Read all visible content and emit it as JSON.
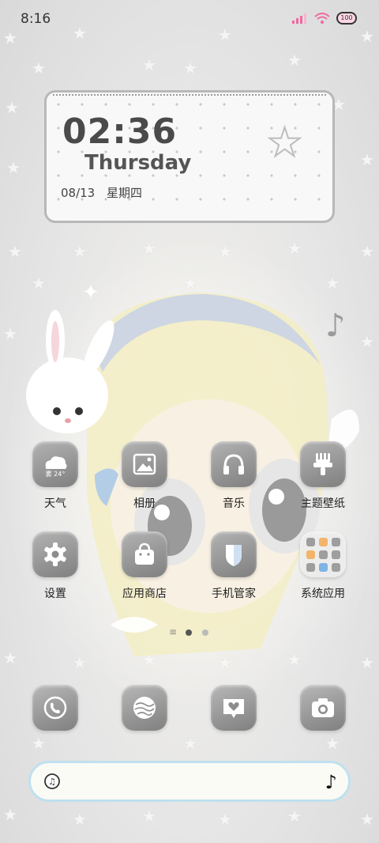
{
  "status_bar": {
    "time": "8:16",
    "battery": "100"
  },
  "widget": {
    "time": "02:36",
    "weekday": "Thursday",
    "date": "08/13",
    "weekday_cn": "星期四"
  },
  "apps": [
    {
      "label": "天气",
      "badge": "雾 24°"
    },
    {
      "label": "相册"
    },
    {
      "label": "音乐"
    },
    {
      "label": "主题壁纸"
    },
    {
      "label": "设置"
    },
    {
      "label": "应用商店"
    },
    {
      "label": "手机管家"
    },
    {
      "label": "系统应用"
    }
  ],
  "pager": {
    "pages": 2,
    "active": 1
  },
  "colors": {
    "tile": "#8c8c8c",
    "accent": "#f06aa0",
    "search_border": "#bfe0ef"
  }
}
